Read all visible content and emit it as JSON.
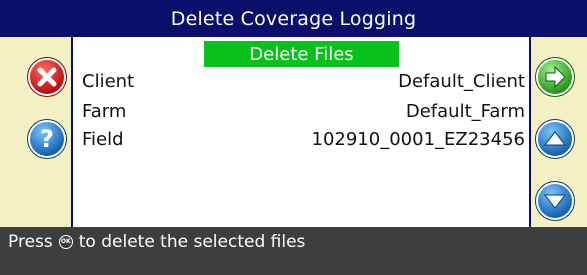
{
  "title": "Delete Coverage Logging",
  "mode_banner": "Delete Files",
  "fields": [
    {
      "label": "Client",
      "value": "Default_Client"
    },
    {
      "label": "Farm",
      "value": "Default_Farm"
    },
    {
      "label": "Field",
      "value": "102910_0001_EZ23456"
    }
  ],
  "status": {
    "prefix": "Press",
    "key_glyph": "OK",
    "suffix": "to delete the selected files"
  },
  "buttons": {
    "cancel": {
      "icon": "cancel-x-icon",
      "glyph": "✕",
      "color": "#d8161c"
    },
    "help": {
      "icon": "help-question-icon",
      "glyph": "?",
      "color": "#1c7fd2"
    },
    "next": {
      "icon": "arrow-right-icon",
      "color": "#2fb61e"
    },
    "up": {
      "icon": "arrow-up-icon",
      "color": "#1c7fd2"
    },
    "down": {
      "icon": "arrow-down-icon",
      "color": "#1c7fd2"
    }
  },
  "colors": {
    "title_bar": "#0b0f6c",
    "side_panel": "#f3f0c3",
    "banner": "#07c21a",
    "status_bar": "#3e3e3e"
  }
}
